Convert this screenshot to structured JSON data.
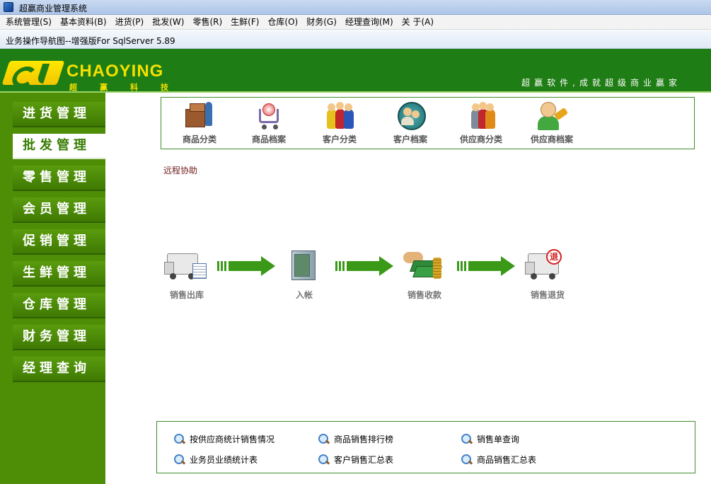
{
  "window": {
    "title": "超赢商业管理系统"
  },
  "menu": [
    "系统管理(S)",
    "基本资料(B)",
    "进货(P)",
    "批发(W)",
    "零售(R)",
    "生鲜(F)",
    "仓库(O)",
    "财务(G)",
    "经理查询(M)",
    "关 于(A)"
  ],
  "doc_tab": "业务操作导航图--增强版For SqlServer 5.89",
  "banner": {
    "brand_en": "CHAOYING",
    "brand_cn": "超赢科技",
    "slogan": "超赢软件,成就超级商业赢家",
    "colors": {
      "green": "#1e7d14",
      "yellow": "#f5e000"
    }
  },
  "sidebar": {
    "items": [
      {
        "label": "进货管理",
        "active": false
      },
      {
        "label": "批发管理",
        "active": true
      },
      {
        "label": "零售管理",
        "active": false
      },
      {
        "label": "会员管理",
        "active": false
      },
      {
        "label": "促销管理",
        "active": false
      },
      {
        "label": "生鲜管理",
        "active": false
      },
      {
        "label": "仓库管理",
        "active": false
      },
      {
        "label": "财务管理",
        "active": false
      },
      {
        "label": "经理查询",
        "active": false
      }
    ]
  },
  "modules": [
    {
      "label": "商品分类",
      "icon": "boxes-icon"
    },
    {
      "label": "商品档案",
      "icon": "cart-icon"
    },
    {
      "label": "客户分类",
      "icon": "people-group-icon"
    },
    {
      "label": "客户档案",
      "icon": "customer-circle-icon"
    },
    {
      "label": "供应商分类",
      "icon": "supplier-group-icon"
    },
    {
      "label": "供应商档案",
      "icon": "supplier-key-icon"
    }
  ],
  "remote_help": "远程协助",
  "flow": [
    {
      "label": "销售出库",
      "icon": "truck-icon"
    },
    {
      "label": "入帐",
      "icon": "safe-icon"
    },
    {
      "label": "销售收款",
      "icon": "cash-icon"
    },
    {
      "label": "销售退货",
      "icon": "return-truck-icon",
      "badge": "退"
    }
  ],
  "reports": [
    [
      "按供应商统计销售情况",
      "商品销售排行榜",
      "销售单查询"
    ],
    [
      "业务员业绩统计表",
      "客户销售汇总表",
      "商品销售汇总表"
    ]
  ]
}
